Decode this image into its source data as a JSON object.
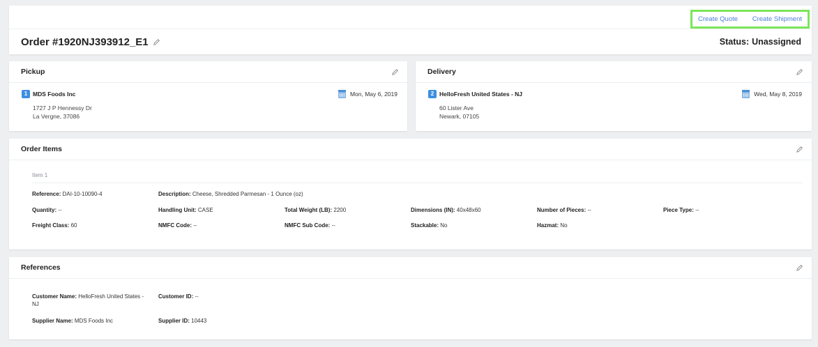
{
  "header": {
    "create_quote": "Create Quote",
    "create_shipment": "Create Shipment",
    "order_title": "Order #1920NJ393912_E1",
    "status_label": "Status:",
    "status_value": "Unassigned"
  },
  "pickup": {
    "title": "Pickup",
    "number": "1",
    "name": "MDS Foods Inc",
    "address_line1": "1727 J P Hennessy Dr",
    "address_line2": "La Vergne, 37086",
    "date": "Mon, May 6, 2019"
  },
  "delivery": {
    "title": "Delivery",
    "number": "2",
    "name": "HelloFresh United States - NJ",
    "address_line1": "60 Lister Ave",
    "address_line2": "Newark, 07105",
    "date": "Wed, May 8, 2019"
  },
  "order_items": {
    "title": "Order Items",
    "item_label": "Item 1",
    "reference_label": "Reference:",
    "reference_value": "DAI-10-10090-4",
    "description_label": "Description:",
    "description_value": "Cheese, Shredded Parmesan - 1 Ounce (oz)",
    "quantity_label": "Quantity:",
    "quantity_value": "--",
    "handling_unit_label": "Handling Unit:",
    "handling_unit_value": "CASE",
    "total_weight_label": "Total Weight (LB):",
    "total_weight_value": "2200",
    "dimensions_label": "Dimensions (IN):",
    "dimensions_value": "40x48x60",
    "pieces_label": "Number of Pieces:",
    "pieces_value": "--",
    "piece_type_label": "Piece Type:",
    "piece_type_value": "--",
    "freight_class_label": "Freight Class:",
    "freight_class_value": "60",
    "nmfc_code_label": "NMFC Code:",
    "nmfc_code_value": "--",
    "nmfc_sub_label": "NMFC Sub Code:",
    "nmfc_sub_value": "--",
    "stackable_label": "Stackable:",
    "stackable_value": "No",
    "hazmat_label": "Hazmat:",
    "hazmat_value": "No"
  },
  "references": {
    "title": "References",
    "customer_name_label": "Customer Name:",
    "customer_name_value": "HelloFresh United States -",
    "customer_name_value_2": "NJ",
    "customer_id_label": "Customer ID:",
    "customer_id_value": "--",
    "supplier_name_label": "Supplier Name:",
    "supplier_name_value": "MDS Foods Inc",
    "supplier_id_label": "Supplier ID:",
    "supplier_id_value": "10443"
  },
  "colors": {
    "accent": "#4a7fd6",
    "highlight": "#7ae65a",
    "badge": "#3d8fe0"
  },
  "icons": [
    "pencil-icon",
    "calendar-icon"
  ]
}
